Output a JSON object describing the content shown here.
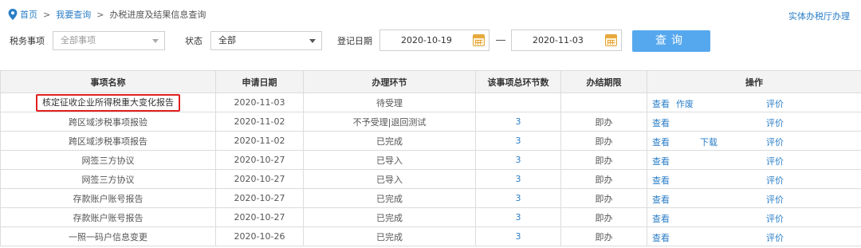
{
  "breadcrumb": {
    "home": "首页",
    "sep": ">",
    "query": "我要查询",
    "current": "办税进度及结果信息查询"
  },
  "header_link": "实体办税厅办理",
  "filters": {
    "tax_matter_label": "税务事项",
    "tax_matter_value": "全部事项",
    "status_label": "状态",
    "status_value": "全部",
    "date_label": "登记日期",
    "date_from": "2020-10-19",
    "date_sep": "—",
    "date_to": "2020-11-03",
    "query_button": "查询"
  },
  "table": {
    "headers": [
      "事项名称",
      "申请日期",
      "办理环节",
      "该事项总环节数",
      "办结期限",
      "操作"
    ],
    "rows": [
      {
        "name": "核定征收企业所得税重大变化报告",
        "date": "2020-11-03",
        "stage": "待受理",
        "total": "",
        "limit": "",
        "ops": [
          "查看",
          "作废",
          "",
          "评价"
        ],
        "highlight": true
      },
      {
        "name": "跨区域涉税事项报验",
        "date": "2020-11-02",
        "stage": "不予受理|退回测试",
        "total": "3",
        "limit": "即办",
        "ops": [
          "查看",
          "",
          "",
          "评价"
        ]
      },
      {
        "name": "跨区域涉税事项报告",
        "date": "2020-11-02",
        "stage": "已完成",
        "total": "3",
        "limit": "即办",
        "ops": [
          "查看",
          "",
          "下载",
          "评价"
        ]
      },
      {
        "name": "网签三方协议",
        "date": "2020-10-27",
        "stage": "已导入",
        "total": "3",
        "limit": "即办",
        "ops": [
          "查看",
          "",
          "",
          "评价"
        ]
      },
      {
        "name": "网签三方协议",
        "date": "2020-10-27",
        "stage": "已导入",
        "total": "3",
        "limit": "即办",
        "ops": [
          "查看",
          "",
          "",
          "评价"
        ]
      },
      {
        "name": "存款账户账号报告",
        "date": "2020-10-27",
        "stage": "已完成",
        "total": "3",
        "limit": "即办",
        "ops": [
          "查看",
          "",
          "",
          "评价"
        ]
      },
      {
        "name": "存款账户账号报告",
        "date": "2020-10-27",
        "stage": "已完成",
        "total": "3",
        "limit": "即办",
        "ops": [
          "查看",
          "",
          "",
          "评价"
        ]
      },
      {
        "name": "一照一码户信息变更",
        "date": "2020-10-26",
        "stage": "已完成",
        "total": "3",
        "limit": "即办",
        "ops": [
          "查看",
          "",
          "",
          "评价"
        ]
      }
    ]
  },
  "colors": {
    "link": "#2a7ec7",
    "button": "#56a8ee",
    "highlight": "#e02020",
    "header_bg": "#f3f3f3"
  }
}
